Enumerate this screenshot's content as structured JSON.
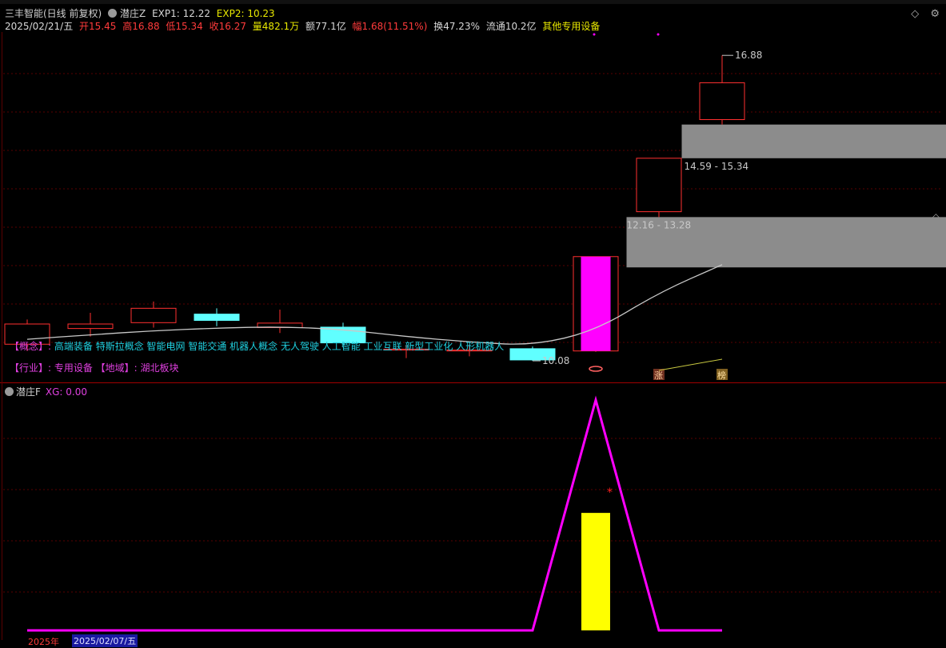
{
  "header": {
    "stock_name": "三丰智能(日线 前复权)",
    "indicator_name": "潜庄Z",
    "exp1": "EXP1: 12.22",
    "exp2": "EXP2: 10.23",
    "date": "2025/02/21/五",
    "open": "开15.45",
    "high": "高16.88",
    "low": "低15.34",
    "close": "收16.27",
    "volume": "量482.1万",
    "amount": "额77.1亿",
    "change": "幅1.68(11.51%)",
    "turnover": "换47.23%",
    "float": "流通10.2亿",
    "sector": "其他专用设备"
  },
  "window_controls": [
    "◇",
    "⚙"
  ],
  "diamond": "◇",
  "concept": {
    "key": "【概念】:",
    "value": "高端装备 特斯拉概念 智能电网 智能交通 机器人概念 无人驾驶 人工智能 工业互联 新型工业化 人形机器人"
  },
  "industry": {
    "text": "【行业】:  专用设备 【地域】: 湖北板块"
  },
  "subchart": {
    "title": "潜庄F",
    "xg": "XG: 0.00"
  },
  "labels": {
    "high_label": "16.88",
    "gap1_label": "14.59 - 15.34",
    "gap2_label": "12.16 - 13.28",
    "low_label": "10.08",
    "tag_zhang": "涨",
    "tag_bang": "榜",
    "star": "*"
  },
  "footer": {
    "year": "2025年",
    "date": "2025/02/07/五"
  },
  "colors": {
    "up": "#ff3030",
    "down": "#60ffff",
    "magenta": "#ff00ff",
    "yellow": "#ffff00",
    "gap": "#8c8c8c",
    "ma": "#c8c8c8",
    "grid": "#5a0000"
  },
  "chart_data": {
    "type": "candlestick",
    "price_ylim": [
      9.6,
      17.4
    ],
    "candles": [
      {
        "open": 10.45,
        "close": 10.9,
        "high": 11.0,
        "low": 10.3,
        "color": "up"
      },
      {
        "open": 10.8,
        "close": 10.9,
        "high": 11.15,
        "low": 10.62,
        "color": "up"
      },
      {
        "open": 10.93,
        "close": 11.25,
        "high": 11.4,
        "low": 10.82,
        "color": "up"
      },
      {
        "open": 11.12,
        "close": 10.98,
        "high": 11.25,
        "low": 10.85,
        "color": "down"
      },
      {
        "open": 10.82,
        "close": 10.92,
        "high": 11.22,
        "low": 10.7,
        "color": "up"
      },
      {
        "open": 10.83,
        "close": 10.48,
        "high": 10.93,
        "low": 10.38,
        "color": "down"
      },
      {
        "open": 10.32,
        "close": 10.34,
        "high": 10.42,
        "low": 10.14,
        "color": "up"
      },
      {
        "open": 10.3,
        "close": 10.32,
        "high": 10.44,
        "low": 10.18,
        "color": "up"
      },
      {
        "open": 10.35,
        "close": 10.1,
        "high": 10.4,
        "low": 10.08,
        "color": "down"
      },
      {
        "open": 10.3,
        "close": 12.4,
        "high": 12.4,
        "low": 10.28,
        "color": "limitup"
      },
      {
        "open": 13.4,
        "close": 14.59,
        "high": 14.59,
        "low": 13.28,
        "color": "up"
      },
      {
        "open": 15.45,
        "close": 16.27,
        "high": 16.88,
        "low": 15.34,
        "color": "up"
      }
    ],
    "ma_line": [
      10.56,
      10.66,
      10.75,
      10.81,
      10.84,
      10.78,
      10.62,
      10.5,
      10.42,
      10.75,
      11.6,
      12.22
    ],
    "gaps": [
      {
        "from": 14.59,
        "to": 15.34,
        "label": "14.59 - 15.34"
      },
      {
        "from": 12.16,
        "to": 13.28,
        "label": "12.16 - 13.28"
      }
    ],
    "indicator": {
      "name": "潜庄F",
      "ylim": [
        0,
        100
      ],
      "line": [
        0,
        0,
        0,
        0,
        0,
        0,
        0,
        0,
        0,
        0,
        0,
        0
      ],
      "peak_index": 9,
      "peak_value": 100,
      "bar_index": 9,
      "bar_value": 51
    }
  }
}
